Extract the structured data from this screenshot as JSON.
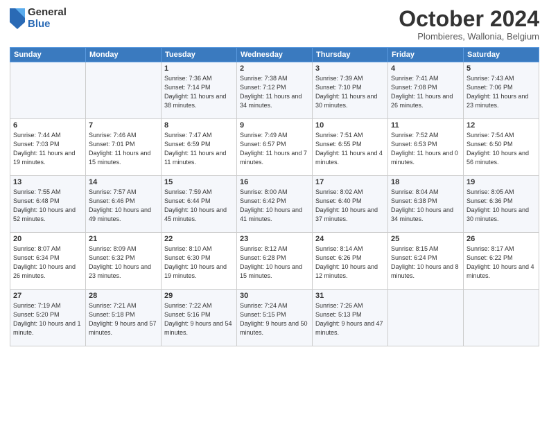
{
  "logo": {
    "general": "General",
    "blue": "Blue"
  },
  "header": {
    "month": "October 2024",
    "location": "Plombieres, Wallonia, Belgium"
  },
  "weekdays": [
    "Sunday",
    "Monday",
    "Tuesday",
    "Wednesday",
    "Thursday",
    "Friday",
    "Saturday"
  ],
  "weeks": [
    [
      {
        "day": "",
        "sunrise": "",
        "sunset": "",
        "daylight": ""
      },
      {
        "day": "",
        "sunrise": "",
        "sunset": "",
        "daylight": ""
      },
      {
        "day": "1",
        "sunrise": "Sunrise: 7:36 AM",
        "sunset": "Sunset: 7:14 PM",
        "daylight": "Daylight: 11 hours and 38 minutes."
      },
      {
        "day": "2",
        "sunrise": "Sunrise: 7:38 AM",
        "sunset": "Sunset: 7:12 PM",
        "daylight": "Daylight: 11 hours and 34 minutes."
      },
      {
        "day": "3",
        "sunrise": "Sunrise: 7:39 AM",
        "sunset": "Sunset: 7:10 PM",
        "daylight": "Daylight: 11 hours and 30 minutes."
      },
      {
        "day": "4",
        "sunrise": "Sunrise: 7:41 AM",
        "sunset": "Sunset: 7:08 PM",
        "daylight": "Daylight: 11 hours and 26 minutes."
      },
      {
        "day": "5",
        "sunrise": "Sunrise: 7:43 AM",
        "sunset": "Sunset: 7:06 PM",
        "daylight": "Daylight: 11 hours and 23 minutes."
      }
    ],
    [
      {
        "day": "6",
        "sunrise": "Sunrise: 7:44 AM",
        "sunset": "Sunset: 7:03 PM",
        "daylight": "Daylight: 11 hours and 19 minutes."
      },
      {
        "day": "7",
        "sunrise": "Sunrise: 7:46 AM",
        "sunset": "Sunset: 7:01 PM",
        "daylight": "Daylight: 11 hours and 15 minutes."
      },
      {
        "day": "8",
        "sunrise": "Sunrise: 7:47 AM",
        "sunset": "Sunset: 6:59 PM",
        "daylight": "Daylight: 11 hours and 11 minutes."
      },
      {
        "day": "9",
        "sunrise": "Sunrise: 7:49 AM",
        "sunset": "Sunset: 6:57 PM",
        "daylight": "Daylight: 11 hours and 7 minutes."
      },
      {
        "day": "10",
        "sunrise": "Sunrise: 7:51 AM",
        "sunset": "Sunset: 6:55 PM",
        "daylight": "Daylight: 11 hours and 4 minutes."
      },
      {
        "day": "11",
        "sunrise": "Sunrise: 7:52 AM",
        "sunset": "Sunset: 6:53 PM",
        "daylight": "Daylight: 11 hours and 0 minutes."
      },
      {
        "day": "12",
        "sunrise": "Sunrise: 7:54 AM",
        "sunset": "Sunset: 6:50 PM",
        "daylight": "Daylight: 10 hours and 56 minutes."
      }
    ],
    [
      {
        "day": "13",
        "sunrise": "Sunrise: 7:55 AM",
        "sunset": "Sunset: 6:48 PM",
        "daylight": "Daylight: 10 hours and 52 minutes."
      },
      {
        "day": "14",
        "sunrise": "Sunrise: 7:57 AM",
        "sunset": "Sunset: 6:46 PM",
        "daylight": "Daylight: 10 hours and 49 minutes."
      },
      {
        "day": "15",
        "sunrise": "Sunrise: 7:59 AM",
        "sunset": "Sunset: 6:44 PM",
        "daylight": "Daylight: 10 hours and 45 minutes."
      },
      {
        "day": "16",
        "sunrise": "Sunrise: 8:00 AM",
        "sunset": "Sunset: 6:42 PM",
        "daylight": "Daylight: 10 hours and 41 minutes."
      },
      {
        "day": "17",
        "sunrise": "Sunrise: 8:02 AM",
        "sunset": "Sunset: 6:40 PM",
        "daylight": "Daylight: 10 hours and 37 minutes."
      },
      {
        "day": "18",
        "sunrise": "Sunrise: 8:04 AM",
        "sunset": "Sunset: 6:38 PM",
        "daylight": "Daylight: 10 hours and 34 minutes."
      },
      {
        "day": "19",
        "sunrise": "Sunrise: 8:05 AM",
        "sunset": "Sunset: 6:36 PM",
        "daylight": "Daylight: 10 hours and 30 minutes."
      }
    ],
    [
      {
        "day": "20",
        "sunrise": "Sunrise: 8:07 AM",
        "sunset": "Sunset: 6:34 PM",
        "daylight": "Daylight: 10 hours and 26 minutes."
      },
      {
        "day": "21",
        "sunrise": "Sunrise: 8:09 AM",
        "sunset": "Sunset: 6:32 PM",
        "daylight": "Daylight: 10 hours and 23 minutes."
      },
      {
        "day": "22",
        "sunrise": "Sunrise: 8:10 AM",
        "sunset": "Sunset: 6:30 PM",
        "daylight": "Daylight: 10 hours and 19 minutes."
      },
      {
        "day": "23",
        "sunrise": "Sunrise: 8:12 AM",
        "sunset": "Sunset: 6:28 PM",
        "daylight": "Daylight: 10 hours and 15 minutes."
      },
      {
        "day": "24",
        "sunrise": "Sunrise: 8:14 AM",
        "sunset": "Sunset: 6:26 PM",
        "daylight": "Daylight: 10 hours and 12 minutes."
      },
      {
        "day": "25",
        "sunrise": "Sunrise: 8:15 AM",
        "sunset": "Sunset: 6:24 PM",
        "daylight": "Daylight: 10 hours and 8 minutes."
      },
      {
        "day": "26",
        "sunrise": "Sunrise: 8:17 AM",
        "sunset": "Sunset: 6:22 PM",
        "daylight": "Daylight: 10 hours and 4 minutes."
      }
    ],
    [
      {
        "day": "27",
        "sunrise": "Sunrise: 7:19 AM",
        "sunset": "Sunset: 5:20 PM",
        "daylight": "Daylight: 10 hours and 1 minute."
      },
      {
        "day": "28",
        "sunrise": "Sunrise: 7:21 AM",
        "sunset": "Sunset: 5:18 PM",
        "daylight": "Daylight: 9 hours and 57 minutes."
      },
      {
        "day": "29",
        "sunrise": "Sunrise: 7:22 AM",
        "sunset": "Sunset: 5:16 PM",
        "daylight": "Daylight: 9 hours and 54 minutes."
      },
      {
        "day": "30",
        "sunrise": "Sunrise: 7:24 AM",
        "sunset": "Sunset: 5:15 PM",
        "daylight": "Daylight: 9 hours and 50 minutes."
      },
      {
        "day": "31",
        "sunrise": "Sunrise: 7:26 AM",
        "sunset": "Sunset: 5:13 PM",
        "daylight": "Daylight: 9 hours and 47 minutes."
      },
      {
        "day": "",
        "sunrise": "",
        "sunset": "",
        "daylight": ""
      },
      {
        "day": "",
        "sunrise": "",
        "sunset": "",
        "daylight": ""
      }
    ]
  ]
}
